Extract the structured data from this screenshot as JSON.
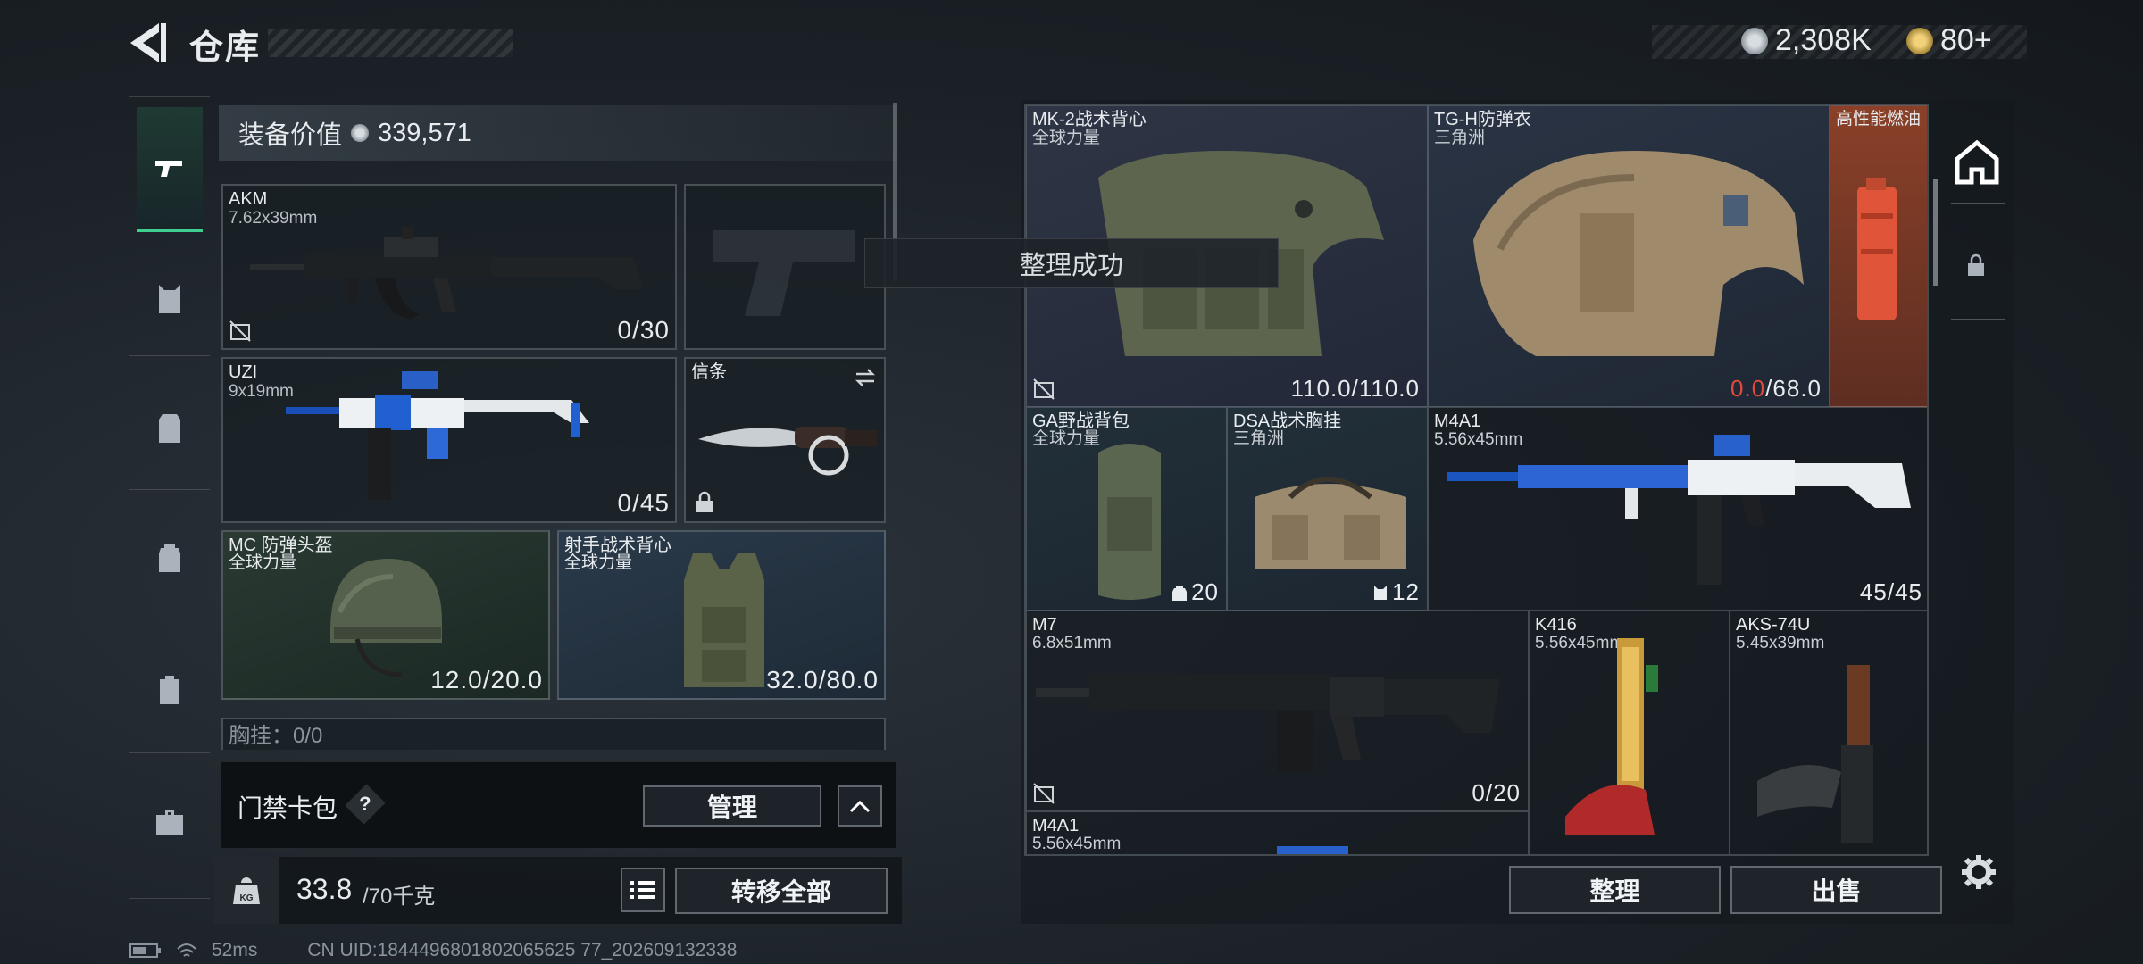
{
  "header": {
    "title": "仓库",
    "currency_1": "2,308K",
    "currency_2": "80+"
  },
  "equip_value": {
    "label": "装备价值",
    "value": "339,571"
  },
  "left_slots": {
    "akm": {
      "name": "AKM",
      "caliber": "7.62x39mm",
      "ammo": "0/30"
    },
    "uzi": {
      "name": "UZI",
      "caliber": "9x19mm",
      "ammo": "0/45"
    },
    "melee": {
      "name": "信条"
    },
    "helmet": {
      "name": "MC 防弹头盔",
      "faction": "全球力量",
      "durability": "12.0/20.0"
    },
    "vest": {
      "name": "射手战术背心",
      "faction": "全球力量",
      "durability": "32.0/80.0"
    },
    "chest_rig": {
      "label": "胸挂：0/0"
    }
  },
  "access_card": {
    "label": "门禁卡包",
    "help": "?",
    "manage_button": "管理"
  },
  "weight": {
    "current": "33.8",
    "max": "/70千克",
    "transfer_button": "转移全部"
  },
  "toast": "整理成功",
  "grid_items": {
    "mk2": {
      "name": "MK-2战术背心",
      "faction": "全球力量",
      "durability": "110.0/110.0"
    },
    "tgh": {
      "name": "TG-H防弹衣",
      "faction": "三角洲",
      "durability_current": "0.0",
      "durability_max": "/68.0"
    },
    "fuel": {
      "name": "高性能燃油"
    },
    "ga_pack": {
      "name": "GA野战背包",
      "faction": "全球力量",
      "capacity": "20"
    },
    "dsa_rig": {
      "name": "DSA战术胸挂",
      "faction": "三角洲",
      "capacity": "12"
    },
    "m4a1": {
      "name": "M4A1",
      "caliber": "5.56x45mm",
      "ammo": "45/45"
    },
    "m7": {
      "name": "M7",
      "caliber": "6.8x51mm",
      "ammo": "0/20"
    },
    "k416": {
      "name": "K416",
      "caliber": "5.56x45mm"
    },
    "aks74u": {
      "name": "AKS-74U",
      "caliber": "5.45x39mm"
    },
    "m4a1_2": {
      "name": "M4A1",
      "caliber": "5.56x45mm"
    }
  },
  "bottom_right": {
    "sort_button": "整理",
    "sell_button": "出售"
  },
  "status": {
    "ping": "52ms",
    "uid": "CN UID:1844496801802065625 77_202609132338"
  },
  "colors": {
    "accent_green": "#3ecf8e",
    "warning_red": "#e04a3a",
    "orange_item": "#b4532c"
  }
}
